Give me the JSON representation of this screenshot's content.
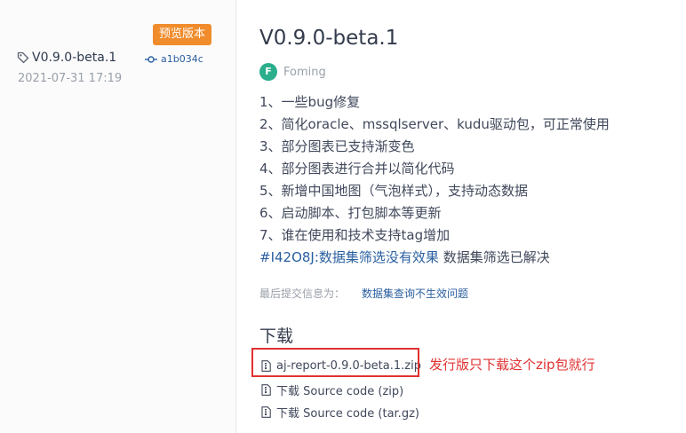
{
  "release": {
    "badge": "预览版本",
    "tag": "V0.9.0-beta.1",
    "commit": "a1b034c",
    "date": "2021-07-31 17:19",
    "title": "V0.9.0-beta.1",
    "author_initial": "F",
    "author": "Foming"
  },
  "notes": [
    "1、一些bug修复",
    "2、简化oracle、mssqlserver、kudu驱动包，可正常使用",
    "3、部分图表已支持渐变色",
    "4、部分图表进行合并以简化代码",
    "5、新增中国地图（气泡样式），支持动态数据",
    "6、启动脚本、打包脚本等更新",
    "7、谁在使用和技术支持tag增加"
  ],
  "issue": {
    "link": "#I42O8J:数据集筛选没有效果",
    "text": " 数据集筛选已解决"
  },
  "last_commit": {
    "label": "最后提交信息为：",
    "message": "数据集查询不生效问题"
  },
  "downloads": {
    "title": "下载",
    "items": [
      "aj-report-0.9.0-beta.1.zip",
      "下载 Source code (zip)",
      "下载 Source code (tar.gz)"
    ]
  },
  "annotation": "发行版只下载这个zip包就行",
  "colors": {
    "badge": "#f08c2b",
    "avatar": "#2bae8d",
    "link": "#2a5fa0",
    "annotation": "#e03131"
  }
}
